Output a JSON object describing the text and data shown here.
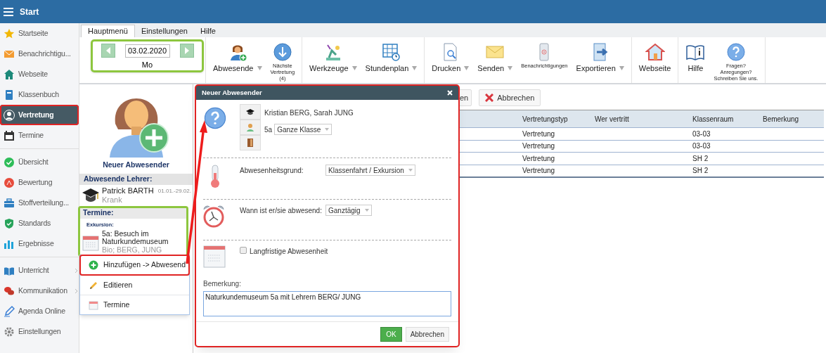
{
  "window": {
    "title": "Start"
  },
  "sidebar": {
    "groups": [
      {
        "items": [
          {
            "label": "Startseite",
            "selected": false,
            "marked": false,
            "has_submenu": false
          },
          {
            "label": "Benachrichtigu...",
            "selected": false,
            "marked": false,
            "has_submenu": false
          },
          {
            "label": "Webseite",
            "selected": false,
            "marked": false,
            "has_submenu": false
          },
          {
            "label": "Klassenbuch",
            "selected": false,
            "marked": false,
            "has_submenu": false
          },
          {
            "label": "Vertretung",
            "selected": true,
            "marked": true,
            "has_submenu": false
          },
          {
            "label": "Termine",
            "selected": false,
            "marked": false,
            "has_submenu": false
          }
        ]
      },
      {
        "items": [
          {
            "label": "Übersicht",
            "selected": false,
            "marked": false,
            "has_submenu": false
          },
          {
            "label": "Bewertung",
            "selected": false,
            "marked": false,
            "has_submenu": false
          },
          {
            "label": "Stoffverteilung...",
            "selected": false,
            "marked": false,
            "has_submenu": false
          },
          {
            "label": "Standards",
            "selected": false,
            "marked": false,
            "has_submenu": false
          },
          {
            "label": "Ergebnisse",
            "selected": false,
            "marked": false,
            "has_submenu": false
          }
        ]
      },
      {
        "items": [
          {
            "label": "Unterricht",
            "selected": false,
            "marked": false,
            "has_submenu": true
          },
          {
            "label": "Kommunikation",
            "selected": false,
            "marked": false,
            "has_submenu": true
          },
          {
            "label": "Agenda Online",
            "selected": false,
            "marked": false,
            "has_submenu": false
          },
          {
            "label": "Einstellungen",
            "selected": false,
            "marked": false,
            "has_submenu": false
          }
        ]
      }
    ]
  },
  "ribbon": {
    "tabs": [
      {
        "label": "Hauptmenü",
        "selected": true
      },
      {
        "label": "Einstellungen",
        "selected": false
      },
      {
        "label": "Hilfe",
        "selected": false
      }
    ],
    "date_nav": {
      "date": "03.02.2020",
      "weekday": "Mo",
      "marked": true
    },
    "groups": [
      {
        "items": [
          {
            "lines": [
              "Abwesende"
            ],
            "kind": "large",
            "dropdown": true
          },
          {
            "lines": [
              "Nächste",
              "Vertretung",
              "(4)"
            ],
            "kind": "small",
            "dropdown": false
          }
        ]
      },
      {
        "items": [
          {
            "lines": [
              "Werkzeuge"
            ],
            "kind": "large",
            "dropdown": true
          },
          {
            "lines": [
              "Stundenplan"
            ],
            "kind": "large",
            "dropdown": true
          }
        ]
      },
      {
        "items": [
          {
            "lines": [
              "Drucken"
            ],
            "kind": "large",
            "dropdown": true
          },
          {
            "lines": [
              "Senden"
            ],
            "kind": "large",
            "dropdown": true
          },
          {
            "lines": [
              "Benachrichtigungen"
            ],
            "kind": "small",
            "dropdown": false
          },
          {
            "lines": [
              "Exportieren"
            ],
            "kind": "large",
            "dropdown": true
          }
        ]
      },
      {
        "items": [
          {
            "lines": [
              "Webseite"
            ],
            "kind": "large",
            "dropdown": false
          }
        ]
      },
      {
        "items": [
          {
            "lines": [
              "Hilfe"
            ],
            "kind": "large",
            "dropdown": false
          },
          {
            "lines": [
              "Fragen?",
              "Anregungen?",
              "Schreiben Sie uns."
            ],
            "kind": "small",
            "dropdown": false
          }
        ]
      }
    ]
  },
  "absent_panel": {
    "new_button": "Neuer Abwesender",
    "absent_heading": "Abwesende Lehrer:",
    "teachers": [
      {
        "name": "Patrick BARTH",
        "reason": "Krank",
        "period": "01.01.-29.02."
      }
    ],
    "appointments": {
      "heading": "Termine:",
      "marked": true,
      "category": "Exkursion:",
      "items": [
        {
          "title": "5a: Besuch im Naturkundemuseum",
          "subtitle": "Bio; BERG, JUNG"
        }
      ]
    }
  },
  "context_menu": {
    "items": [
      {
        "label": "Hinzufügen -> Abwesend",
        "marked": true
      },
      {
        "label": "Editieren",
        "marked": false
      },
      {
        "label": "Termine",
        "marked": false
      }
    ]
  },
  "toolbar": {
    "buttons": [
      {
        "label": "en"
      },
      {
        "label": "Abbrechen"
      }
    ]
  },
  "table": {
    "columns": [
      "Vertretungstyp",
      "Wer vertritt",
      "Klassenraum",
      "Bemerkung"
    ],
    "rows": [
      {
        "type": "Vertretung",
        "room": "03-03"
      },
      {
        "type": "Vertretung",
        "room": "03-03"
      },
      {
        "type": "Vertretung",
        "room": "SH 2"
      },
      {
        "type": "Vertretung",
        "room": "SH 2"
      }
    ]
  },
  "dialog": {
    "title": "Neuer Abwesender",
    "marked": true,
    "teachers": "Kristian BERG, Sarah JUNG",
    "class": "5a",
    "class_scope": "Ganze Klasse",
    "reason_label": "Abwesenheitsgrund:",
    "reason": "Klassenfahrt / Exkursion",
    "when_label": "Wann ist er/sie abwesend:",
    "when": "Ganztägig",
    "long_term": {
      "label": "Langfristige Abwesenheit",
      "checked": false
    },
    "remark_label": "Bemerkung:",
    "remark": "Naturkundemuseum 5a mit Lehrern BERG/ JUNG",
    "buttons": [
      {
        "label": "OK",
        "kind": "primary"
      },
      {
        "label": "Abbrechen",
        "kind": "default"
      }
    ]
  }
}
